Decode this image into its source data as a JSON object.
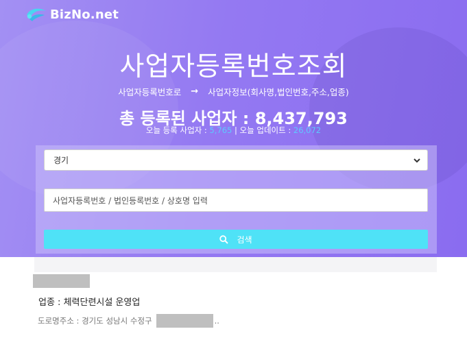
{
  "brand": {
    "name": "BizNo.net"
  },
  "hero": {
    "title": "사업자등록번호조회",
    "subtitle_from": "사업자등록번호로",
    "subtitle_arrow": "→",
    "subtitle_to": "사업자정보(회사명,법인번호,주소,업종)",
    "total_label": "총 등록된 사업자 : ",
    "total_value": "8,437,793",
    "today_label": "오늘 등록 사업자 : ",
    "today_value": "5,765",
    "separator": " | ",
    "update_label": "오늘 업데이트 : ",
    "update_value": "26,072"
  },
  "form": {
    "region_selected": "경기",
    "search_placeholder": "사업자등록번호 / 법인등록번호 / 상호명 입력",
    "search_button_label": "검색"
  },
  "result": {
    "industry": "업종 : 체력단련시설 운영업",
    "address_prefix": "도로명주소 : 경기도 성남시 수정구",
    "address_suffix": ".."
  },
  "colors": {
    "hero_gradient_start": "#a390f3",
    "hero_gradient_end": "#8a6cf0",
    "accent_cyan": "#4fe2f7",
    "stat_number_blue": "#5ec9ff"
  },
  "icons": {
    "logo": "biznet-logo-icon",
    "dropdown": "chevron-down-icon",
    "search": "search-icon"
  }
}
